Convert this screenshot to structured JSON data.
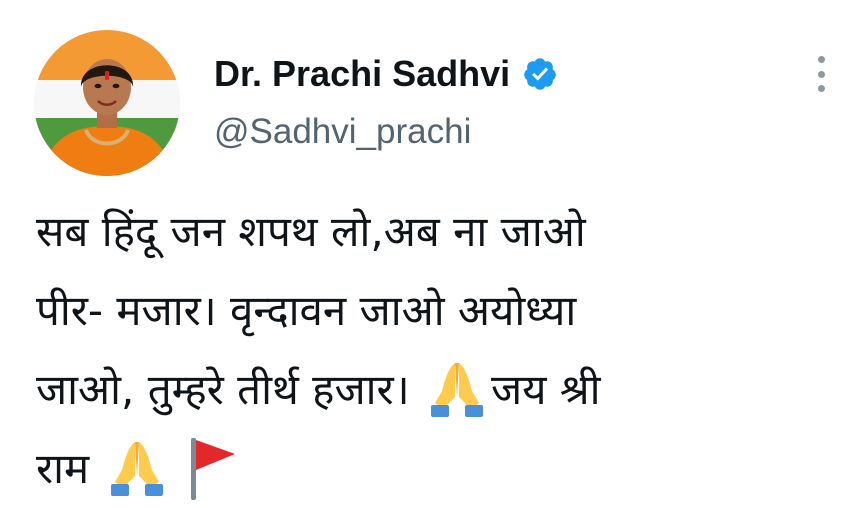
{
  "user": {
    "display_name": "Dr. Prachi Sadhvi",
    "handle": "@Sadhvi_prachi",
    "verified": true,
    "verified_color": "#1d9bf0"
  },
  "icons": {
    "verified": "verified-badge-icon",
    "more": "more-options-icon",
    "folded_hands": "folded-hands-emoji",
    "flag": "triangular-flag-emoji"
  },
  "tweet": {
    "line1": "सब हिंदू जन शपथ लो,अब ना जाओ",
    "line2": "पीर- मजार। वृन्दावन जाओ अयोध्या",
    "line3_a": "जाओ, तुम्हरे तीर्थ हजार। ",
    "line3_b": "जय श्री",
    "line4": "राम "
  },
  "colors": {
    "text": "#0f1419",
    "secondary_text": "#536471",
    "more_dots": "#8e99a3"
  }
}
